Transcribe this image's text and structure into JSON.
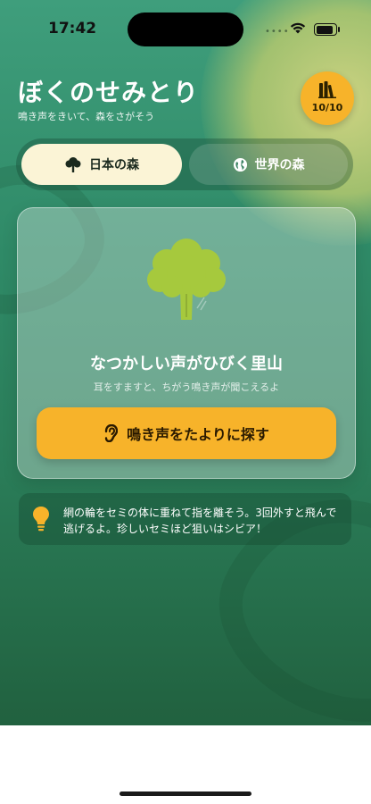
{
  "status_bar": {
    "time": "17:42",
    "signal_dots": "••••"
  },
  "header": {
    "title": "ぼくのせみとり",
    "subtitle": "鳴き声をきいて、森をさがそう",
    "collection_count": "10/10",
    "collection_icon": "books-icon"
  },
  "tabs": [
    {
      "label": "日本の森",
      "icon": "tree-icon",
      "active": true
    },
    {
      "label": "世界の森",
      "icon": "globe-icon",
      "active": false
    }
  ],
  "card": {
    "icon": "broccoli-tree-icon",
    "heading": "なつかしい声がひびく里山",
    "description": "耳をすますと、ちがう鳴き声が聞こえるよ",
    "button_label": "鳴き声をたよりに探す",
    "button_icon": "ear-icon"
  },
  "tip": {
    "icon": "lightbulb-icon",
    "text": "網の輪をセミの体に重ねて指を離そう。3回外すと飛んで逃げるよ。珍しいセミほど狙いはシビア！"
  },
  "colors": {
    "accent": "#f7b32a",
    "background_top": "#3f9e7c",
    "background_bottom": "#21613f",
    "tab_active_bg": "#fbf4d6",
    "leaf_green": "#a6c93d"
  }
}
